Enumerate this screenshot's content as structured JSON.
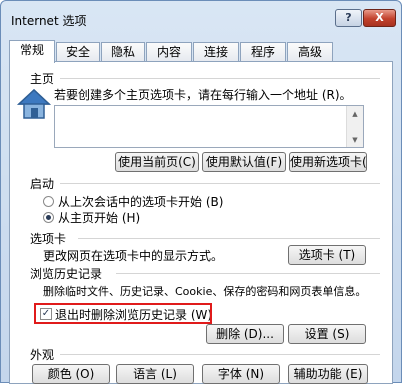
{
  "window": {
    "title": "Internet 选项",
    "help_label": "?",
    "close_label": "X"
  },
  "tabs": [
    {
      "label": "常规"
    },
    {
      "label": "安全"
    },
    {
      "label": "隐私"
    },
    {
      "label": "内容"
    },
    {
      "label": "连接"
    },
    {
      "label": "程序"
    },
    {
      "label": "高级"
    }
  ],
  "homepage": {
    "heading": "主页",
    "description": "若要创建多个主页选项卡，请在每行输入一个地址 (R)。",
    "address_value": "",
    "use_current_label": "使用当前页(C)",
    "use_default_label": "使用默认值(F)",
    "use_new_tab_label": "使用新选项卡(U"
  },
  "startup": {
    "heading": "启动",
    "option_last_session": "从上次会话中的选项卡开始 (B)",
    "option_homepage": "从主页开始 (H)"
  },
  "tabs_section": {
    "heading": "选项卡",
    "description": "更改网页在选项卡中的显示方式。",
    "button_label": "选项卡 (T)"
  },
  "history": {
    "heading": "浏览历史记录",
    "description": "删除临时文件、历史记录、Cookie、保存的密码和网页表单信息。",
    "checkbox_label": "退出时删除浏览历史记录 (W)",
    "checkbox_checked": true,
    "delete_label": "删除 (D)...",
    "settings_label": "设置 (S)"
  },
  "appearance": {
    "heading": "外观",
    "colors_label": "颜色 (O)",
    "languages_label": "语言 (L)",
    "fonts_label": "字体 (N)",
    "accessibility_label": "辅助功能 (E)"
  },
  "colors": {
    "highlight": "#e01b1b",
    "close_button": "#c2412c",
    "title_bar": "#c4d6ec"
  }
}
